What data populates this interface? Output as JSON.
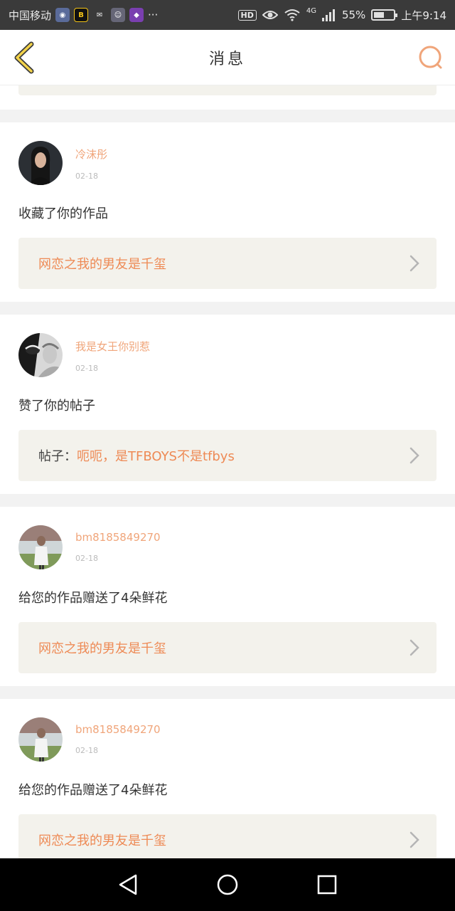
{
  "status_bar": {
    "carrier": "中国移动",
    "dots": "···",
    "hd": "HD",
    "network": "4G",
    "battery_percent_text": "55%",
    "battery_level": 0.55,
    "time": "上午9:14",
    "app_icons": [
      "qq-icon",
      "bilibili-icon",
      "wechat-icon",
      "message-icon",
      "app-icon"
    ]
  },
  "navbar": {
    "title": "消息"
  },
  "notifications": [
    {
      "username": "冷沫彤",
      "date": "02-18",
      "action": "收藏了你的作品",
      "link_prefix": "",
      "link_text": "网恋之我的男友是千玺"
    },
    {
      "username": "我是女王你别惹",
      "date": "02-18",
      "action": "赞了你的帖子",
      "link_prefix": "帖子：",
      "link_text": "呃呃，是TFBOYS不是tfbys"
    },
    {
      "username": "bm8185849270",
      "date": "02-18",
      "action": "给您的作品赠送了4朵鲜花",
      "link_prefix": "",
      "link_text": "网恋之我的男友是千玺"
    },
    {
      "username": "bm8185849270",
      "date": "02-18",
      "action": "给您的作品赠送了4朵鲜花",
      "link_prefix": "",
      "link_text": "网恋之我的男友是千玺"
    }
  ],
  "colors": {
    "accent": "#ee8a55",
    "username": "#f0a57a",
    "link_box": "#f3f2ec"
  }
}
